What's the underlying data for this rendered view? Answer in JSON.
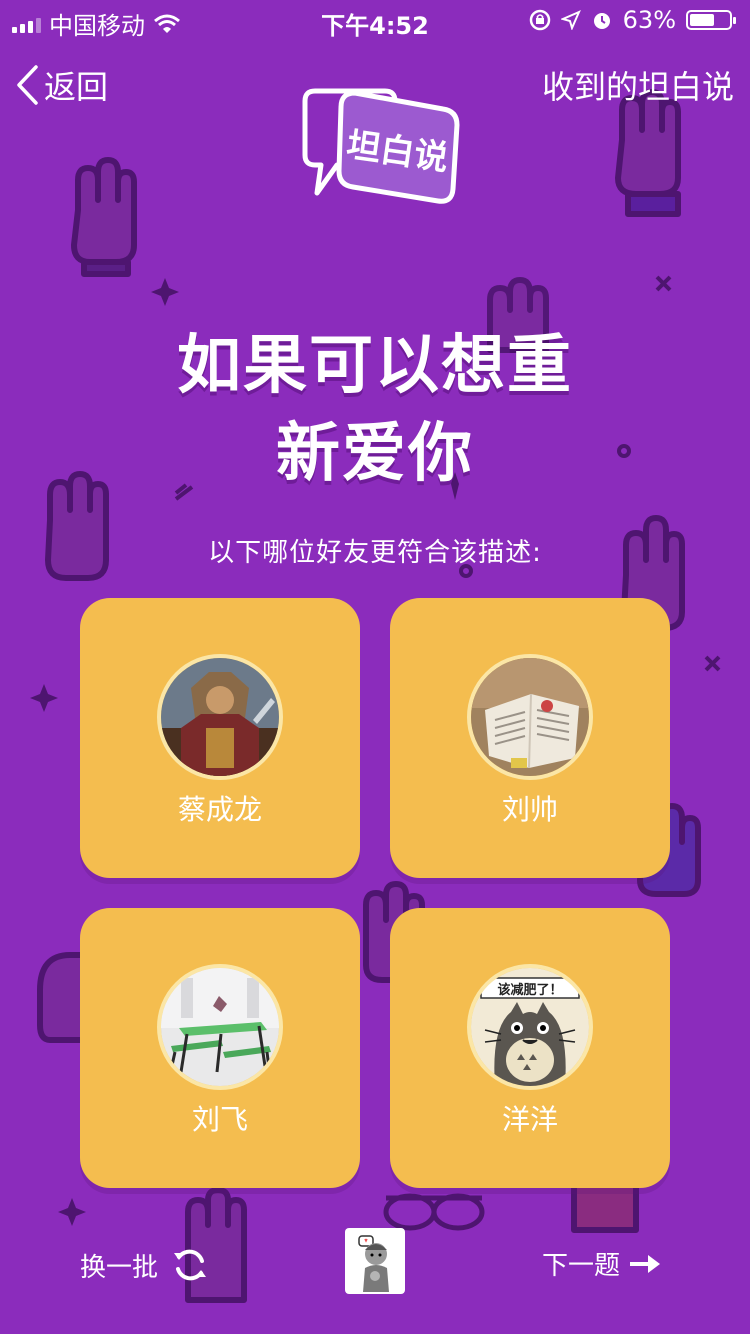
{
  "status_bar": {
    "carrier": "中国移动",
    "time": "下午4:52",
    "battery_percent": "63%",
    "battery_level": 0.63
  },
  "nav": {
    "back_label": "返回",
    "received_label": "收到的坦白说"
  },
  "logo": {
    "text": "坦白说"
  },
  "question": {
    "line1": "如果可以想重",
    "line2": "新爱你"
  },
  "subtitle": "以下哪位好友更符合该描述:",
  "friends": [
    {
      "name": "蔡成龙"
    },
    {
      "name": "刘帅"
    },
    {
      "name": "刘飞"
    },
    {
      "name": "洋洋"
    }
  ],
  "avatar4_caption": "该减肥了！",
  "bottom": {
    "shuffle_label": "换一批",
    "next_label": "下一题"
  },
  "colors": {
    "background": "#8b2cbc",
    "card": "#f4bd4f",
    "text": "#ffffff"
  }
}
